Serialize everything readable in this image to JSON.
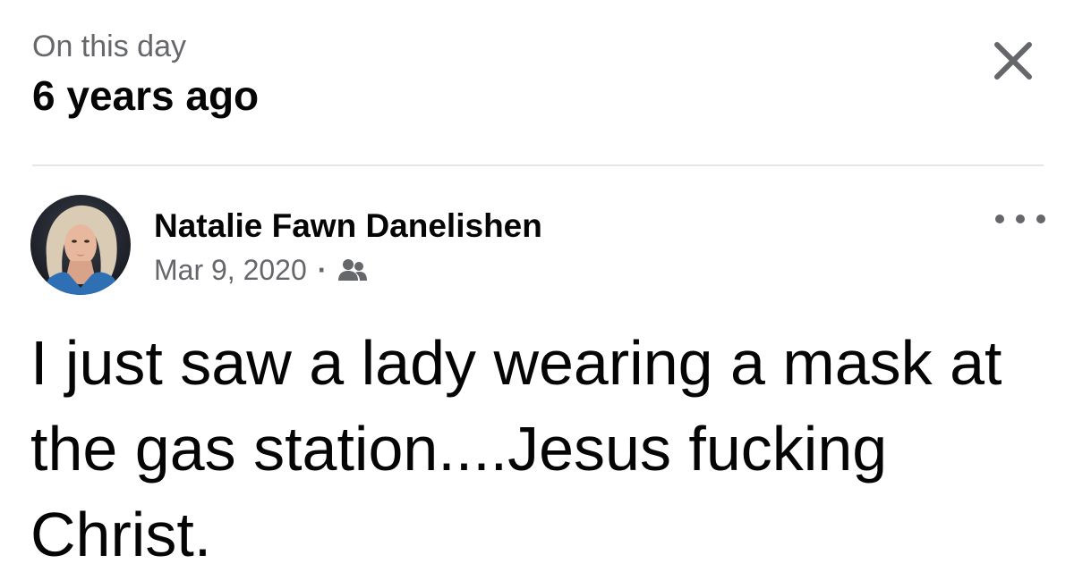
{
  "header": {
    "eyebrow": "On this day",
    "title": "6 years ago",
    "close_icon": "close-icon"
  },
  "post": {
    "author": "Natalie Fawn Danelishen",
    "date": "Mar 9, 2020",
    "separator": "·",
    "audience_icon": "friends-icon",
    "more_icon": "more-options-icon",
    "text": "I just saw a lady wearing a mask at the gas station....Jesus fucking Christ."
  },
  "colors": {
    "primary_text": "#050505",
    "secondary_text": "#65676b",
    "divider": "#e4e6eb"
  }
}
